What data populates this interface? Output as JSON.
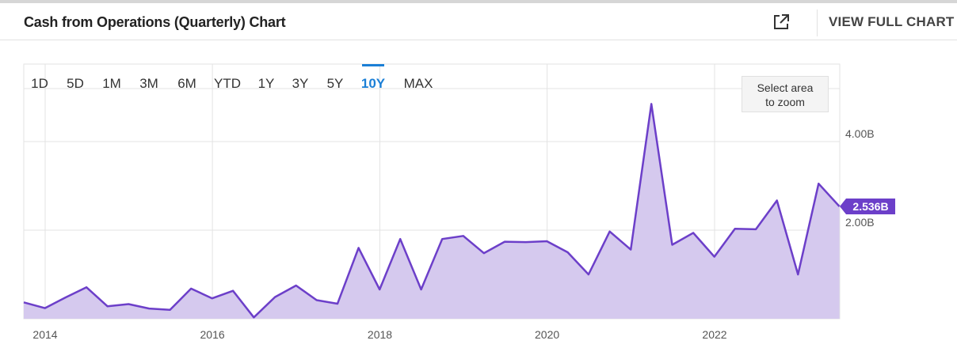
{
  "header": {
    "title": "Cash from Operations (Quarterly) Chart",
    "external_icon": "external-link-icon",
    "full_chart_label": "VIEW FULL CHART"
  },
  "ranges": {
    "items": [
      "1D",
      "5D",
      "1M",
      "3M",
      "6M",
      "YTD",
      "1Y",
      "3Y",
      "5Y",
      "10Y",
      "MAX"
    ],
    "active": "10Y",
    "active_color": "#1b7fd6"
  },
  "zoom_hint": {
    "line1": "Select area",
    "line2": "to zoom"
  },
  "last_value_label": "2.536B",
  "chart_data": {
    "type": "area",
    "title": "Cash from Operations (Quarterly) Chart",
    "xlabel": "",
    "ylabel": "",
    "x_ticks": [
      "2014",
      "2016",
      "2018",
      "2020",
      "2022"
    ],
    "y_ticks": [
      "4.00B",
      "2.00B"
    ],
    "ylim": [
      0.0,
      5.75
    ],
    "y_unit": "B",
    "grid": true,
    "line_color": "#6c3fc9",
    "fill_color": "#d5c9ee",
    "series": [
      {
        "name": "",
        "points": [
          [
            "2013-09-30",
            0.37
          ],
          [
            "2013-12-31",
            0.24
          ],
          [
            "2014-03-31",
            0.48
          ],
          [
            "2014-06-30",
            0.71
          ],
          [
            "2014-09-30",
            0.28
          ],
          [
            "2014-12-31",
            0.33
          ],
          [
            "2015-03-31",
            0.23
          ],
          [
            "2015-06-30",
            0.2
          ],
          [
            "2015-09-30",
            0.68
          ],
          [
            "2015-12-31",
            0.46
          ],
          [
            "2016-03-31",
            0.63
          ],
          [
            "2016-06-30",
            0.03
          ],
          [
            "2016-09-30",
            0.49
          ],
          [
            "2016-12-31",
            0.75
          ],
          [
            "2017-03-31",
            0.42
          ],
          [
            "2017-06-30",
            0.34
          ],
          [
            "2017-09-30",
            1.6
          ],
          [
            "2017-12-31",
            0.66
          ],
          [
            "2018-03-31",
            1.8
          ],
          [
            "2018-06-30",
            0.66
          ],
          [
            "2018-09-30",
            1.8
          ],
          [
            "2018-12-31",
            1.87
          ],
          [
            "2019-03-31",
            1.48
          ],
          [
            "2019-06-30",
            1.74
          ],
          [
            "2019-09-30",
            1.73
          ],
          [
            "2019-12-31",
            1.75
          ],
          [
            "2020-03-31",
            1.5
          ],
          [
            "2020-06-30",
            1.0
          ],
          [
            "2020-09-30",
            1.97
          ],
          [
            "2020-12-31",
            1.56
          ],
          [
            "2021-03-31",
            4.85
          ],
          [
            "2021-06-30",
            1.67
          ],
          [
            "2021-09-30",
            1.94
          ],
          [
            "2021-12-31",
            1.4
          ],
          [
            "2022-03-31",
            2.03
          ],
          [
            "2022-06-30",
            2.02
          ],
          [
            "2022-09-30",
            2.67
          ],
          [
            "2022-12-31",
            1.0
          ],
          [
            "2023-03-31",
            3.05
          ],
          [
            "2023-06-30",
            2.536
          ]
        ]
      }
    ]
  }
}
